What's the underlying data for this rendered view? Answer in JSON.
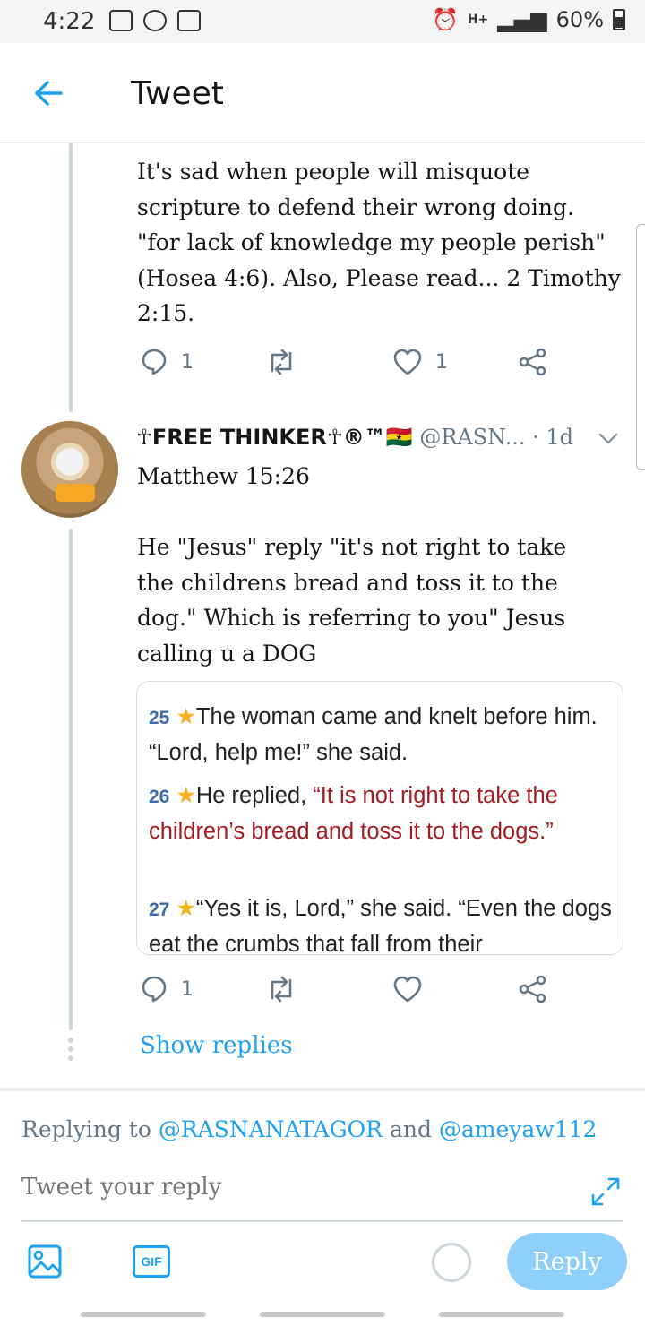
{
  "status_bar": {
    "time": "4:22",
    "network": "H+",
    "battery": "60%"
  },
  "header": {
    "title": "Tweet",
    "back_icon": "arrow-left-icon"
  },
  "tweet1": {
    "text": "It's sad when people will misquote scripture to defend their wrong doing. \"for lack of knowledge my people perish\"(Hosea 4:6). Also, Please read... 2 Timothy 2:15.",
    "reply_count": "1",
    "like_count": "1"
  },
  "tweet2": {
    "display_name": "☥FREE THINKER☥®™🇬🇭",
    "handle": "@RASN...",
    "time": "· 1d",
    "text_line1": "Matthew 15:26",
    "text_body": "He \"Jesus\" reply \"it's not right to take the childrens bread and toss it to the dog.\" Which is referring to you\" Jesus calling u a DOG",
    "reply_count": "1",
    "verses": [
      {
        "num": "25",
        "text": "The woman came and knelt before him. “Lord, help me!” she said."
      },
      {
        "num": "26",
        "lead": "He replied, ",
        "quote": "“It is not right to take the children’s bread and toss it to the dogs.”"
      },
      {
        "num": "27",
        "text": "“Yes it is, Lord,” she said. “Even the dogs eat the crumbs that fall from their"
      }
    ]
  },
  "show_replies": "Show replies",
  "composer": {
    "replying_prefix": "Replying to ",
    "mention1": "@RASNANATAGOR",
    "and": " and ",
    "mention2": "@ameyaw112",
    "placeholder": "Tweet your reply",
    "gif_label": "GIF",
    "reply_label": "Reply"
  },
  "colors": {
    "accent": "#1da1f2",
    "verse_quote": "#a11d21",
    "reply_button": "#8ed0f9"
  }
}
